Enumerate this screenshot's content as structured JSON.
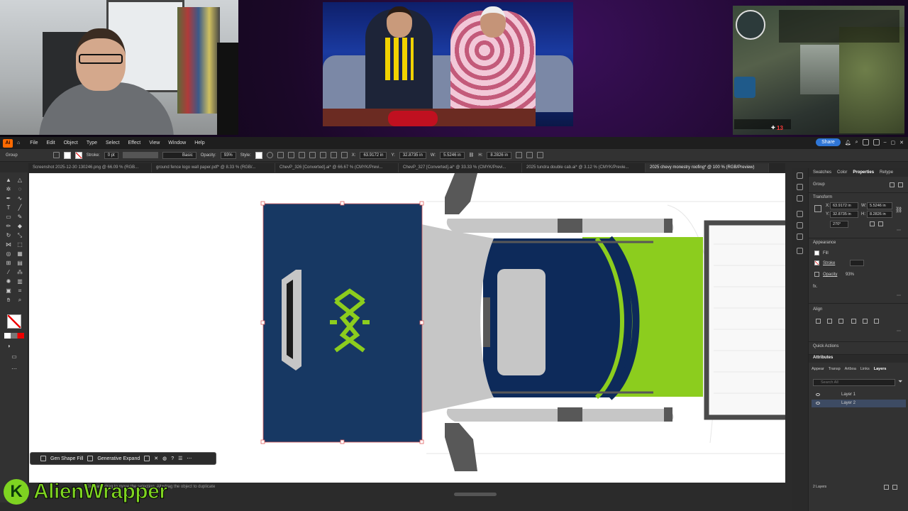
{
  "app": {
    "menu": [
      "File",
      "Edit",
      "Object",
      "Type",
      "Select",
      "Effect",
      "View",
      "Window",
      "Help"
    ],
    "share_label": "Share"
  },
  "control_bar": {
    "group_label": "Group",
    "stroke_label": "Stroke:",
    "stroke_value": "0 pt",
    "brush_label": "Basic",
    "opacity_label": "Opacity:",
    "opacity_value": "93%",
    "style_label": "Style:",
    "x_label": "X:",
    "x_value": "63.9172 in",
    "y_label": "Y:",
    "y_value": "32.8735 in",
    "w_label": "W:",
    "w_value": "5.5246 in",
    "h_label": "H:",
    "h_value": "8.2826 in"
  },
  "tabs": [
    {
      "label": "Screenshot 2025-12-30 130246.png @ 66.09 % (RGB..."
    },
    {
      "label": "ground fence logo wall paper.pdf* @ 8.33 % (RGB/..."
    },
    {
      "label": "ChevP_326 [Converted].ai* @ 66.67 % (CMYK/Previ..."
    },
    {
      "label": "ChevP_327 [Converted].ai* @ 33.33 % (CMYK/Previ..."
    },
    {
      "label": "2025 tundra double cab.ai* @ 3.12 % (CMYK/Previe..."
    },
    {
      "label": "2025 chevy monestry roofing* @ 100 % (RGB/Preview)"
    }
  ],
  "context_bar": {
    "gen_shape_fill": "Gen Shape Fill",
    "generative_expand": "Generative Expand"
  },
  "status_bar": {
    "hint": "Click and drag to move the selection. Alt+drag the object to duplicate"
  },
  "properties_panel": {
    "tabs": [
      "Swatches",
      "Color",
      "Properties",
      "Retype"
    ],
    "active_tab": "Properties",
    "group_label": "Group",
    "transform_label": "Transform",
    "x_label": "X:",
    "x_value": "63.9172 in",
    "y_label": "Y:",
    "y_value": "32.8735 in",
    "w_label": "W:",
    "w_value": "5.5246 in",
    "h_label": "H:",
    "h_value": "8.2826 in",
    "rotate_value": "270°",
    "appearance_label": "Appearance",
    "fill_label": "Fill",
    "stroke_label": "Stroke",
    "opacity_label": "Opacity",
    "opacity_value": "93%",
    "fx_label": "fx.",
    "align_label": "Align",
    "quick_actions_label": "Quick Actions"
  },
  "attributes_panel": {
    "header": "Attributes",
    "tabs": [
      "Appear",
      "Transp",
      "Artboa",
      "Links",
      "Layers"
    ],
    "active_tab": "Layers",
    "search_placeholder": "Search All",
    "layers": [
      {
        "name": "Layer 1",
        "selected": false
      },
      {
        "name": "Layer 2",
        "selected": true
      }
    ],
    "layers_count": "2 Layers"
  },
  "game_hud": {
    "health": "13"
  },
  "branding": {
    "logo_letter": "K",
    "name": "AlienWrapper"
  },
  "colors": {
    "navy": "#173863",
    "dark_navy": "#0d2a5a",
    "lime": "#8ccd1e",
    "light_gray": "#c6c6c6",
    "mid_gray": "#585858",
    "accent": "#2f76d6"
  }
}
